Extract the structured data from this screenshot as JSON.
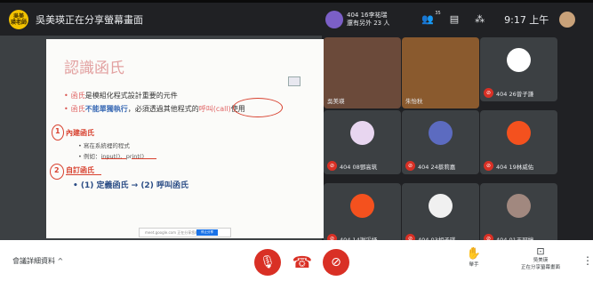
{
  "share": {
    "avatar_text": "吳美\n瑛老師",
    "title": "吳美瑛正在分享螢幕畫面"
  },
  "slide": {
    "title": "認識函氏",
    "bullet1_kw": "函氏",
    "bullet1_rest": "是模組化程式設計重要的元件",
    "bullet2_a": "函氏",
    "bullet2_b": "不能單獨執行",
    "bullet2_c": "，必須透過其他程式的",
    "bullet2_d": "呼叫(call)",
    "bullet2_e": "使用",
    "ink_num1": "1",
    "section1": "內建函氏",
    "sub1": "寫在系統裡的程式",
    "sub2_prefix": "例如",
    "sub2_a": "input()",
    "sub2_b": "print()",
    "ink_num2": "2",
    "section2": "自訂函氏",
    "big_line": "(1) 定義函氏 → (2) 呼叫函氏",
    "search_text": "meet.google.com 正在分享您的畫面。",
    "search_button": "停止分享"
  },
  "topbar": {
    "presenter_line1": "404 16李祐瑞",
    "presenter_line2": "還有另外 23 人",
    "people_count": "35",
    "time": "9:17 上午"
  },
  "participants": [
    {
      "name": "吳美瑛",
      "color": "#6b4a3a",
      "muted": false,
      "video": true
    },
    {
      "name": "朱怡秋",
      "color": "#8a5a2e",
      "muted": false,
      "video": true
    },
    {
      "name": "404 26曾子謙",
      "color": "#ffffff",
      "muted": true,
      "video": false
    },
    {
      "name": "404 08鄧高筑",
      "color": "#e8d6f0",
      "muted": true,
      "video": false
    },
    {
      "name": "404 24蔡莉嘉",
      "color": "#5c6bc0",
      "muted": true,
      "video": false
    },
    {
      "name": "404 19林威佑",
      "color": "#f4511e",
      "muted": true,
      "video": false
    },
    {
      "name": "404 14謝采妤",
      "color": "#f4511e",
      "muted": true,
      "video": false
    },
    {
      "name": "404 03胡子琪",
      "color": "#f0f0f0",
      "muted": true,
      "video": false
    },
    {
      "name": "404 01王冠婷",
      "color": "#a1887f",
      "muted": true,
      "video": false
    }
  ],
  "bottom": {
    "meeting_details": "會議詳細資料 ^",
    "raise_hand": "舉手",
    "present_line1": "吳美瑛",
    "present_line2": "正在分享螢幕畫面",
    "mic_color": "#d93025",
    "cam_color": "#d93025"
  }
}
